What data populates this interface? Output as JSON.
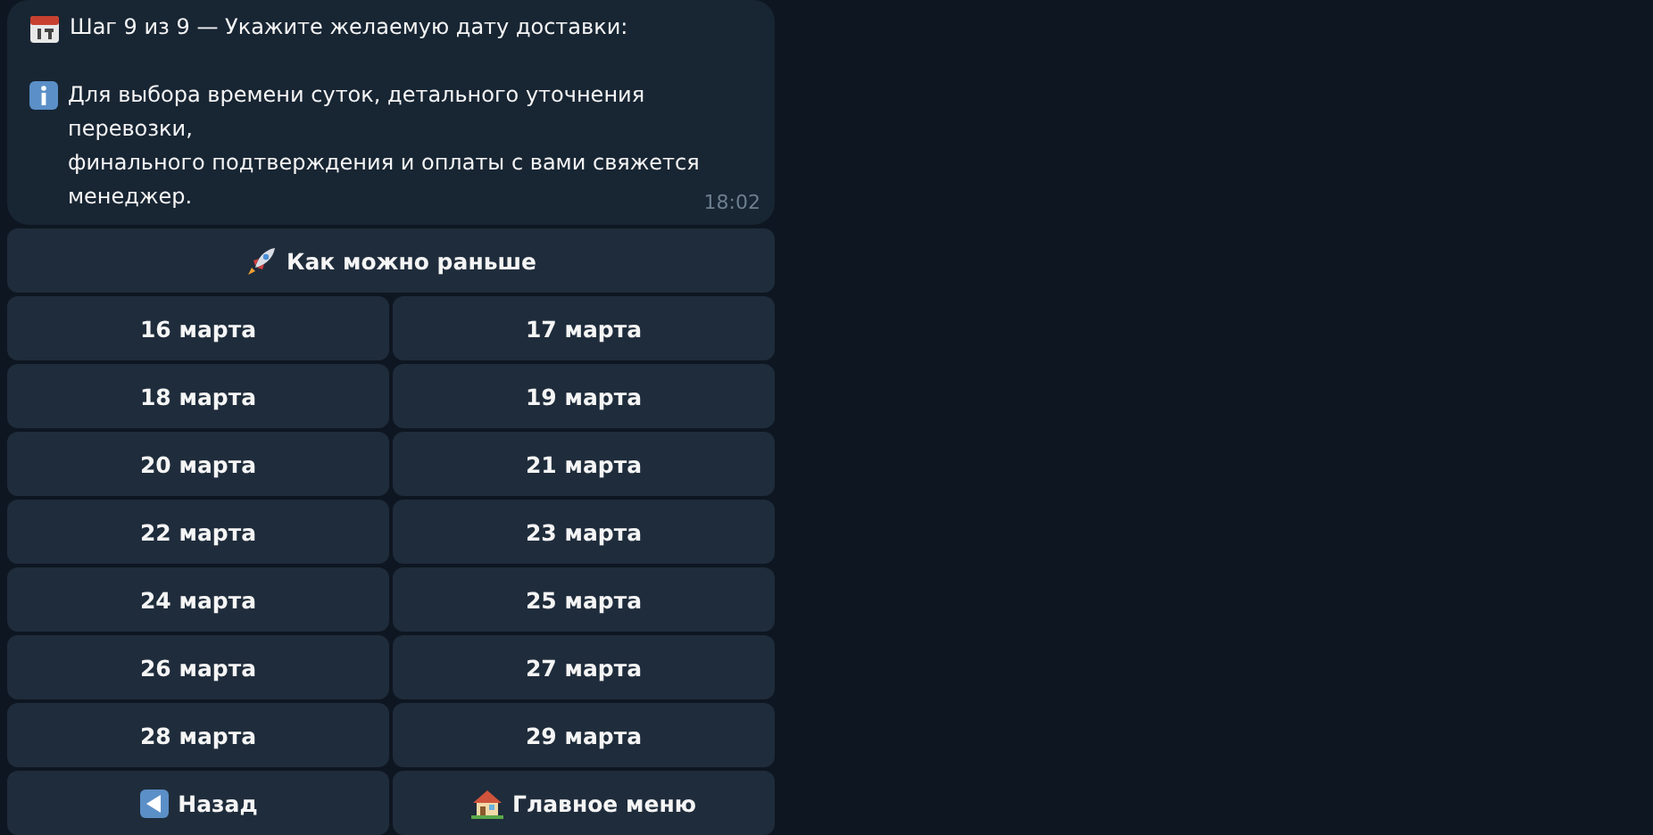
{
  "message": {
    "title": "Шаг 9 из 9 — Укажите желаемую дату доставки:",
    "info": "Для выбора времени суток, детального уточнения\nперевозки,\nфинального подтверждения и оплаты с вами свяжется\nменеджер.",
    "time": "18:02"
  },
  "keyboard": [
    [
      {
        "label": "Как можно раньше",
        "kind": "urgent"
      }
    ],
    [
      {
        "label": "16 марта",
        "kind": "date"
      },
      {
        "label": "17 марта",
        "kind": "date"
      }
    ],
    [
      {
        "label": "18 марта",
        "kind": "date"
      },
      {
        "label": "19 марта",
        "kind": "date"
      }
    ],
    [
      {
        "label": "20 марта",
        "kind": "date"
      },
      {
        "label": "21 марта",
        "kind": "date"
      }
    ],
    [
      {
        "label": "22 марта",
        "kind": "date"
      },
      {
        "label": "23 марта",
        "kind": "date"
      }
    ],
    [
      {
        "label": "24 марта",
        "kind": "date"
      },
      {
        "label": "25 марта",
        "kind": "date"
      }
    ],
    [
      {
        "label": "26 марта",
        "kind": "date"
      },
      {
        "label": "27 марта",
        "kind": "date"
      }
    ],
    [
      {
        "label": "28 марта",
        "kind": "date"
      },
      {
        "label": "29 марта",
        "kind": "date"
      }
    ],
    [
      {
        "label": "Назад",
        "kind": "back"
      },
      {
        "label": "Главное меню",
        "kind": "home"
      }
    ]
  ]
}
